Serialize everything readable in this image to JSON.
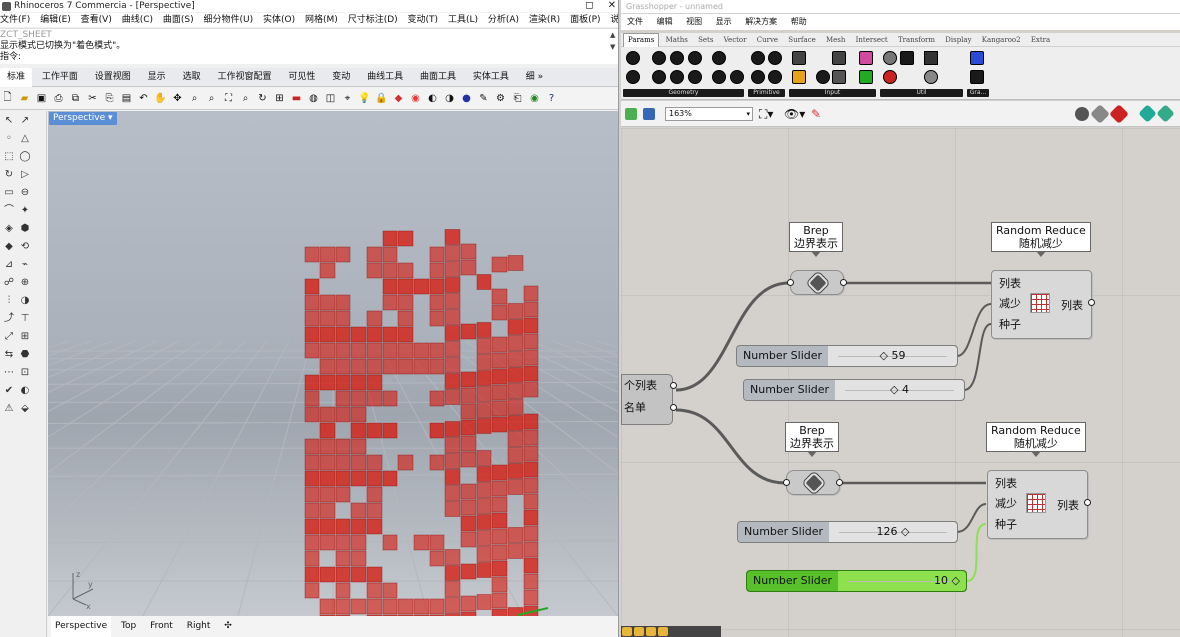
{
  "rhino": {
    "title": "Rhinoceros 7 Commercia - [Perspective]",
    "menu": [
      "文件(F)",
      "编辑(E)",
      "查看(V)",
      "曲线(C)",
      "曲面(S)",
      "细分物件(U)",
      "实体(O)",
      "网格(M)",
      "尺寸标注(D)",
      "变动(T)",
      "工具(L)",
      "分析(A)",
      "渲染(R)",
      "面板(P)",
      "说明(H)"
    ],
    "command_history": [
      "ZCT_SHEET",
      "显示模式已切换为\"着色模式\"。",
      "指令:"
    ],
    "tabs": [
      "标准",
      "工作平面",
      "设置视图",
      "显示",
      "选取",
      "工作视窗配置",
      "可见性",
      "变动",
      "曲线工具",
      "曲面工具",
      "实体工具",
      "细 »"
    ],
    "active_tab": "标准",
    "viewport_label": "Perspective",
    "viewport_tabs": [
      "Perspective",
      "Top",
      "Front",
      "Right",
      "✣"
    ],
    "active_viewport_tab": "Perspective",
    "axis": {
      "x": "x",
      "y": "y",
      "z": "z"
    }
  },
  "gh": {
    "title": "Grasshopper - unnamed",
    "menu": [
      "文件",
      "编辑",
      "视图",
      "显示",
      "解决方案",
      "帮助"
    ],
    "component_tabs": [
      "Params",
      "Maths",
      "Sets",
      "Vector",
      "Curve",
      "Surface",
      "Mesh",
      "Intersect",
      "Transform",
      "Display",
      "Kangaroo2",
      "Extra"
    ],
    "active_component_tab": "Params",
    "groups": [
      "Geometry",
      "Primitive",
      "Input",
      "Util",
      "Gra..."
    ],
    "zoom": "163%",
    "list_component": {
      "out1": "个列表",
      "out2": "名单"
    },
    "brep1": {
      "en": "Brep",
      "cn": "边界表示"
    },
    "brep2": {
      "en": "Brep",
      "cn": "边界表示"
    },
    "rr1": {
      "en": "Random Reduce",
      "cn": "随机减少",
      "in": [
        "列表",
        "减少",
        "种子"
      ],
      "out": "列表"
    },
    "rr2": {
      "en": "Random Reduce",
      "cn": "随机减少",
      "in": [
        "列表",
        "减少",
        "种子"
      ],
      "out": "列表"
    },
    "sliders": [
      {
        "label": "Number Slider",
        "value": "◇ 59"
      },
      {
        "label": "Number Slider",
        "value": "◇ 4"
      },
      {
        "label": "Number Slider",
        "value": "126 ◇"
      },
      {
        "label": "Number Slider",
        "value": "10 ◇"
      }
    ]
  },
  "colors": {
    "brep_red": "#d61b10",
    "slider_green": "#58c02a",
    "viewport_tab_blue": "#5a8fd6"
  }
}
